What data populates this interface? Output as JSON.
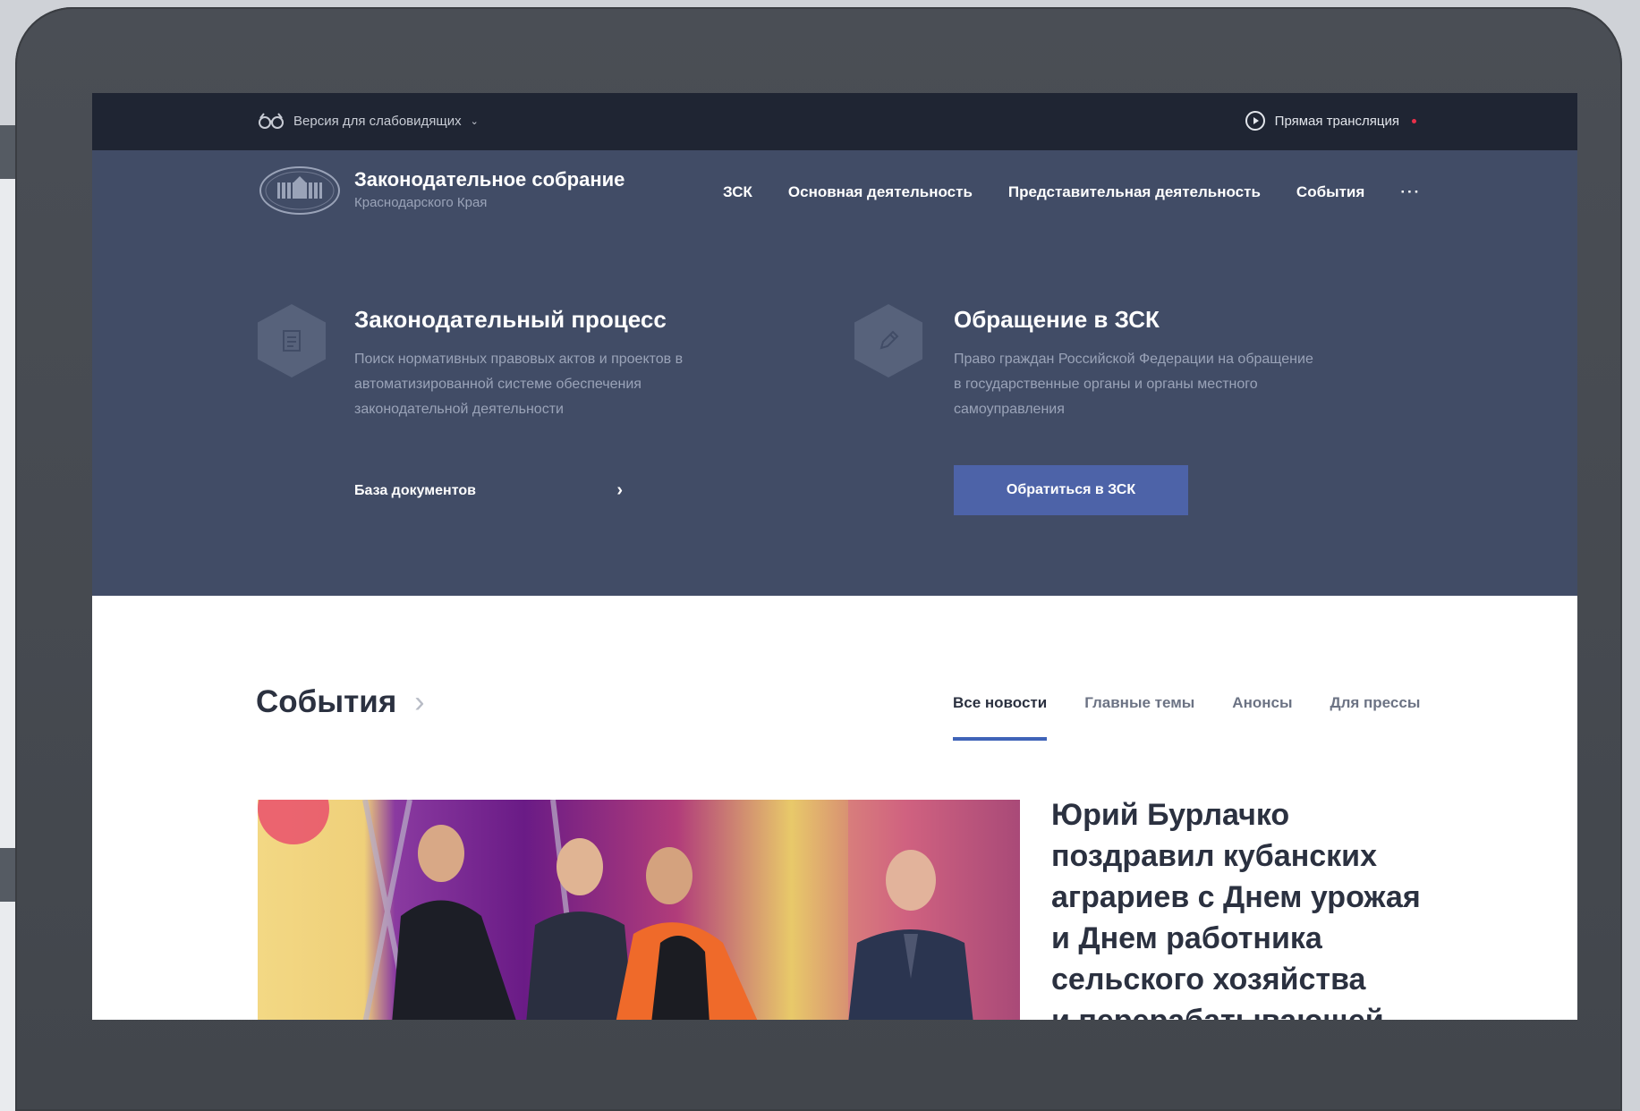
{
  "topbar": {
    "accessibility_label": "Версия для слабовидящих",
    "live_label": "Прямая трансляция"
  },
  "header": {
    "org_name": "Законодательное собрание",
    "org_subtitle": "Краснодарского Края",
    "nav": [
      "ЗСК",
      "Основная деятельность",
      "Представительная деятельность",
      "События",
      "···"
    ]
  },
  "hero": {
    "left": {
      "title": "Законодательный процесс",
      "description": [
        "Поиск нормативных правовых актов и проектов в",
        "автоматизированной системе обеспечения",
        "законодательной деятельности"
      ],
      "link_label": "База документов"
    },
    "right": {
      "title": "Обращение в ЗСК",
      "description": [
        "Право граждан Российской Федерации на обращение",
        "в государственные органы и органы местного",
        "самоуправления"
      ],
      "button_label": "Обратиться в ЗСК"
    }
  },
  "events": {
    "title": "События",
    "tabs": [
      "Все новости",
      "Главные темы",
      "Анонсы",
      "Для прессы"
    ],
    "active_tab": "Все новости",
    "news_title_lines": [
      "Юрий Бурлачко",
      "поздравил кубанских",
      "аграриев с Днем урожая",
      "и Днем работника",
      "сельского хозяйства",
      "и перерабатывающей"
    ]
  },
  "colors": {
    "topbar": "#1f2533",
    "header": "#414c66",
    "accent": "#4d63a8",
    "tab_underline": "#3f63b8",
    "live_dot": "#e9304a"
  },
  "icons": [
    "glasses-icon",
    "play-circle-icon",
    "document-icon",
    "pencil-icon",
    "chevron-right-icon"
  ]
}
